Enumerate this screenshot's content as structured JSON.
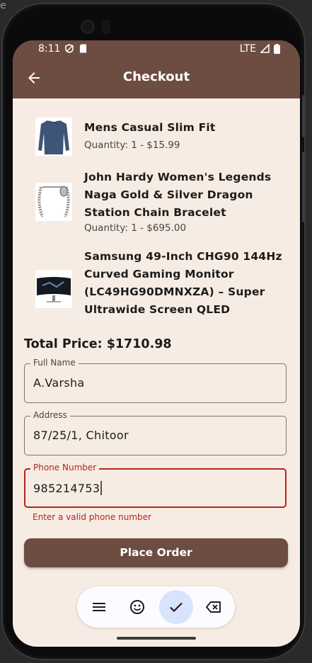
{
  "window_corner_glyph": "e",
  "status_bar": {
    "time": "8:11",
    "network": "LTE"
  },
  "app_bar": {
    "title": "Checkout"
  },
  "items": [
    {
      "name": "Mens Casual Slim Fit",
      "quantity_price": "Quantity: 1 - $15.99"
    },
    {
      "name": "John Hardy Women's Legends Naga Gold & Silver Dragon Station Chain Bracelet",
      "quantity_price": "Quantity: 1 - $695.00"
    },
    {
      "name": "Samsung 49-Inch CHG90 144Hz Curved Gaming Monitor (LC49HG90DMNXZA) – Super Ultrawide Screen QLED",
      "quantity_price": ""
    }
  ],
  "total": "Total Price: $1710.98",
  "form": {
    "full_name": {
      "label": "Full Name",
      "value": "A.Varsha"
    },
    "address": {
      "label": "Address",
      "value": "87/25/1, Chitoor"
    },
    "phone": {
      "label": "Phone Number",
      "value": "985214753",
      "error": "Enter a valid phone number"
    }
  },
  "place_order_label": "Place Order",
  "keyboard_toolbar": [
    "menu-icon",
    "emoji-icon",
    "check-icon",
    "backspace-icon"
  ],
  "colors": {
    "primary": "#6d4c41",
    "background": "#f6ece3",
    "error": "#b3261e",
    "accent_active": "#d9e3fb"
  }
}
